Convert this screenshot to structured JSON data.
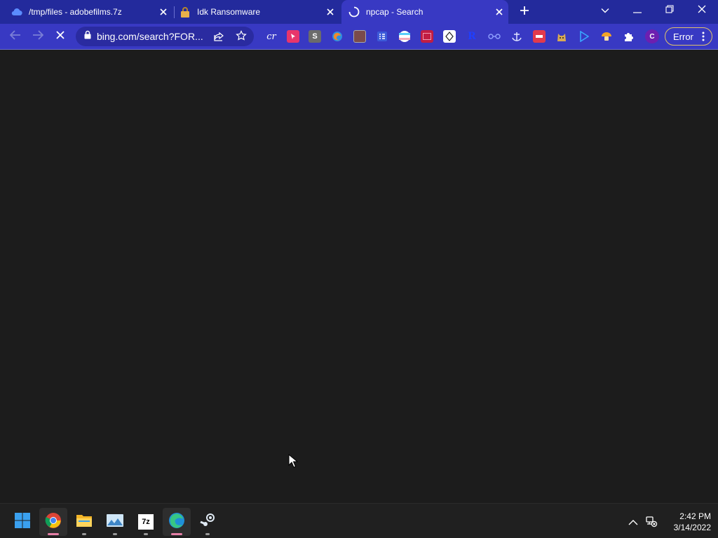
{
  "browser": {
    "tabs": [
      {
        "title": "/tmp/files - adobefilms.7z",
        "favicon": "cloud-icon",
        "active": false
      },
      {
        "title": "Idk Ransomware",
        "favicon": "padlock-icon",
        "active": false
      },
      {
        "title": "npcap - Search",
        "favicon": "loading-spinner-icon",
        "active": true
      }
    ],
    "new_tab_icon": "plus-icon",
    "tab_search_icon": "chevron-down-icon",
    "window_controls": [
      "minimize-icon",
      "restore-icon",
      "close-icon"
    ]
  },
  "toolbar": {
    "back_icon": "arrow-left-icon",
    "forward_icon": "arrow-right-icon",
    "stop_icon": "close-icon",
    "url": "bing.com/search?FOR...",
    "share_icon": "share-icon",
    "bookmark_icon": "star-icon",
    "extensions": [
      {
        "name": "cr-extension-icon",
        "label": "cr"
      },
      {
        "name": "pointer-extension-icon",
        "label": ""
      },
      {
        "name": "s-extension-icon",
        "label": "S"
      },
      {
        "name": "edge-like-extension-icon",
        "label": ""
      },
      {
        "name": "box-extension-icon",
        "label": ""
      },
      {
        "name": "grid-extension-icon",
        "label": ""
      },
      {
        "name": "stripes-extension-icon",
        "label": ""
      },
      {
        "name": "picture-extension-icon",
        "label": ""
      },
      {
        "name": "diamond-extension-icon",
        "label": ""
      },
      {
        "name": "r-extension-icon",
        "label": "R"
      },
      {
        "name": "link-extension-icon",
        "label": ""
      },
      {
        "name": "anchor-extension-icon",
        "label": ""
      },
      {
        "name": "card-extension-icon",
        "label": ""
      },
      {
        "name": "doge-extension-icon",
        "label": ""
      },
      {
        "name": "play-extension-icon",
        "label": ""
      },
      {
        "name": "mushroom-extension-icon",
        "label": ""
      },
      {
        "name": "puzzle-icon",
        "label": ""
      }
    ],
    "profile_initial": "C",
    "error_label": "Error"
  },
  "taskbar": {
    "apps": [
      {
        "name": "windows-start-icon",
        "running": false
      },
      {
        "name": "chrome-icon",
        "running": true
      },
      {
        "name": "file-explorer-icon",
        "running": true
      },
      {
        "name": "photos-icon",
        "running": true
      },
      {
        "name": "7zip-icon",
        "label": "7z",
        "running": true
      },
      {
        "name": "edge-icon",
        "running": true
      },
      {
        "name": "steam-icon",
        "running": true
      }
    ],
    "tray": [
      "chevron-up-icon",
      "network-disconnected-icon"
    ],
    "time": "2:42 PM",
    "date": "3/14/2022"
  },
  "colors": {
    "tabstrip": "#232a9c",
    "toolbar": "#3839c3",
    "page": "#1c1c1c",
    "taskbar": "#202020",
    "error_border": "#e0c36a"
  }
}
